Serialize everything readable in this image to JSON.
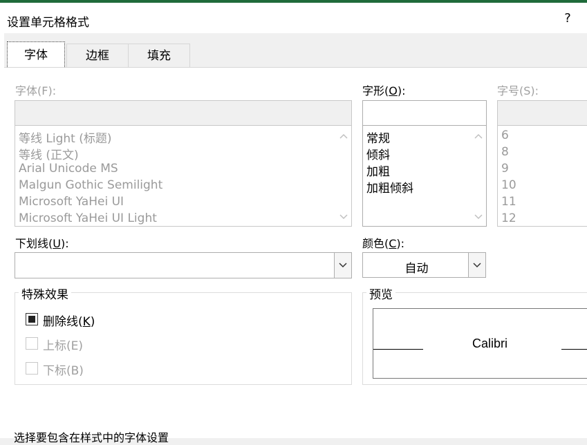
{
  "dialog": {
    "title": "设置单元格格式",
    "help": "?"
  },
  "tabs": [
    {
      "label": "字体",
      "active": true
    },
    {
      "label": "边框",
      "active": false
    },
    {
      "label": "填充",
      "active": false
    }
  ],
  "font": {
    "label": "字体(F):",
    "value": "",
    "items": [
      "等线 Light (标题)",
      "等线 (正文)",
      "Arial Unicode MS",
      "Malgun Gothic Semilight",
      "Microsoft YaHei UI",
      "Microsoft YaHei UI Light"
    ]
  },
  "style": {
    "label_prefix": "字形(",
    "label_key": "O",
    "label_suffix": "):",
    "value": "",
    "items": [
      "常规",
      "倾斜",
      "加粗",
      "加粗倾斜"
    ]
  },
  "size": {
    "label": "字号(S):",
    "value": "",
    "items": [
      "6",
      "8",
      "9",
      "10",
      "11",
      "12"
    ]
  },
  "underline": {
    "label_prefix": "下划线(",
    "label_key": "U",
    "label_suffix": "):",
    "value": ""
  },
  "color": {
    "label_prefix": "颜色(",
    "label_key": "C",
    "label_suffix": "):",
    "value": "自动"
  },
  "effects": {
    "title": "特殊效果",
    "strikethrough": {
      "label_prefix": "删除线(",
      "label_key": "K",
      "label_suffix": ")",
      "state": "indeterminate"
    },
    "superscript": {
      "label": "上标(E)",
      "checked": false
    },
    "subscript": {
      "label": "下标(B)",
      "checked": false
    }
  },
  "preview": {
    "title": "预览",
    "sample": "Calibri"
  },
  "footer_note": "选择要包含在样式中的字体设置"
}
